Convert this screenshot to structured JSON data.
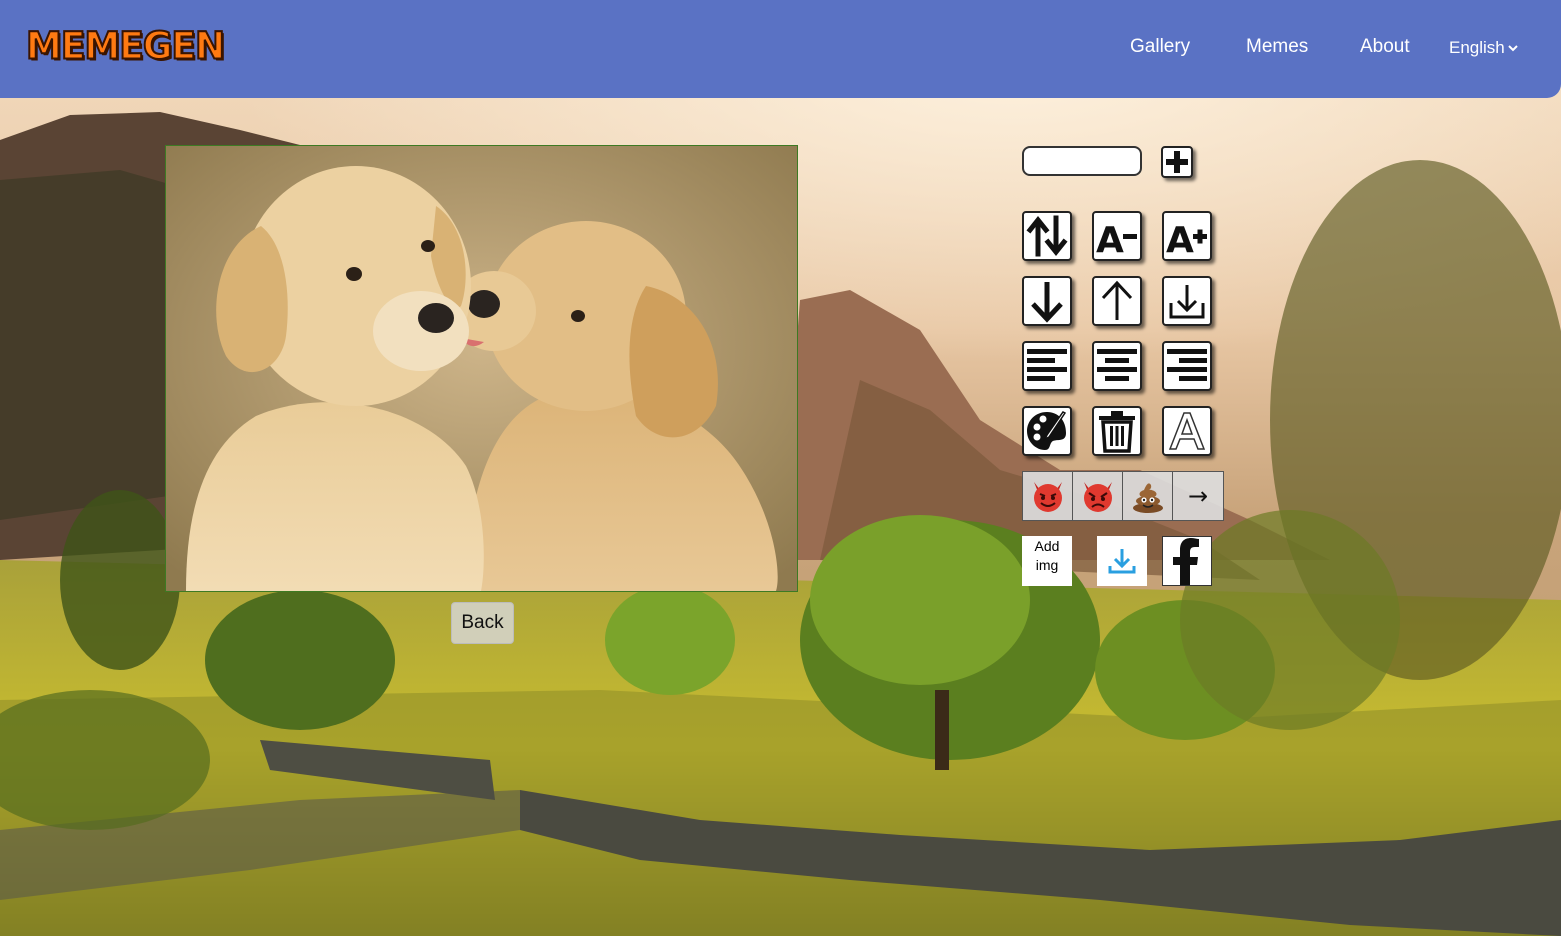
{
  "header": {
    "logo_text": "MEMEGEN",
    "nav": [
      "Gallery",
      "Memes",
      "About"
    ],
    "language": "English",
    "bg_color": "#5a72c4"
  },
  "editor": {
    "text_input_value": "",
    "add_line_icon": "plus-icon",
    "tools": [
      {
        "name": "switch-line",
        "icon": "arrows-up-down-icon"
      },
      {
        "name": "font-decrease",
        "icon": "font-decrease-icon",
        "label": "A−"
      },
      {
        "name": "font-increase",
        "icon": "font-increase-icon",
        "label": "A+"
      },
      {
        "name": "move-down",
        "icon": "arrow-down-icon"
      },
      {
        "name": "move-up",
        "icon": "arrow-up-icon"
      },
      {
        "name": "save",
        "icon": "download-tray-icon"
      },
      {
        "name": "align-left",
        "icon": "align-left-icon"
      },
      {
        "name": "align-center",
        "icon": "align-center-icon"
      },
      {
        "name": "align-right",
        "icon": "align-right-icon"
      },
      {
        "name": "color",
        "icon": "palette-icon"
      },
      {
        "name": "delete",
        "icon": "trash-icon"
      },
      {
        "name": "stroke",
        "icon": "outline-a-icon",
        "label": "A"
      }
    ],
    "emojis": [
      "smiling-devil-icon",
      "angry-devil-icon",
      "poop-icon"
    ],
    "emoji_next": "→",
    "add_img_label": "Add img",
    "download_icon": "download-icon",
    "share_icon": "facebook-icon"
  },
  "canvas": {
    "image": "two-puppies-photo",
    "back_label": "Back"
  }
}
